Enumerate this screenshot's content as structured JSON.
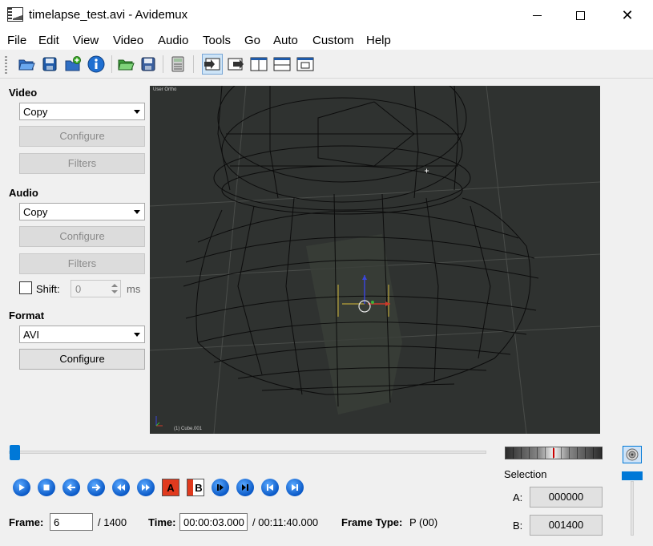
{
  "window": {
    "title": "timelapse_test.avi - Avidemux",
    "buttons": {
      "minimize": "—",
      "maximize": "☐",
      "close": "✕"
    }
  },
  "menu": [
    "File",
    "Edit",
    "View",
    "Video",
    "Audio",
    "Tools",
    "Go",
    "Auto",
    "Custom",
    "Help"
  ],
  "toolbar": {
    "icons": [
      "open-file",
      "save-video",
      "append-file",
      "info",
      "open-folder",
      "save-project",
      "calculator",
      "view-input",
      "view-output",
      "view-side-by-side",
      "view-top-bottom",
      "view-preview"
    ]
  },
  "video": {
    "title": "Video",
    "codec": "Copy",
    "configure_label": "Configure",
    "filters_label": "Filters"
  },
  "audio": {
    "title": "Audio",
    "codec": "Copy",
    "configure_label": "Configure",
    "filters_label": "Filters",
    "shift_label": "Shift:",
    "shift_value": "0",
    "shift_unit": "ms"
  },
  "format": {
    "title": "Format",
    "container": "AVI",
    "configure_label": "Configure"
  },
  "viewport": {
    "overlay_label": "User Ortho",
    "object_label": "(1) Cube.001"
  },
  "playback": {
    "position_fraction": 0.0043,
    "marker_a": "A",
    "marker_b": "B"
  },
  "selection": {
    "title": "Selection",
    "a_label": "A:",
    "a_value": "000000",
    "b_label": "B:",
    "b_value": "001400"
  },
  "status": {
    "frame_label": "Frame:",
    "frame_value": "6",
    "frame_total": "/ 1400",
    "time_label": "Time:",
    "time_value": "00:00:03.000",
    "time_total": "/ 00:11:40.000",
    "frame_type_label": "Frame Type:",
    "frame_type_value": "P (00)"
  },
  "colors": {
    "accent": "#0078d7",
    "viewport_bg": "#2f3230",
    "marker_red": "#cc0000"
  }
}
